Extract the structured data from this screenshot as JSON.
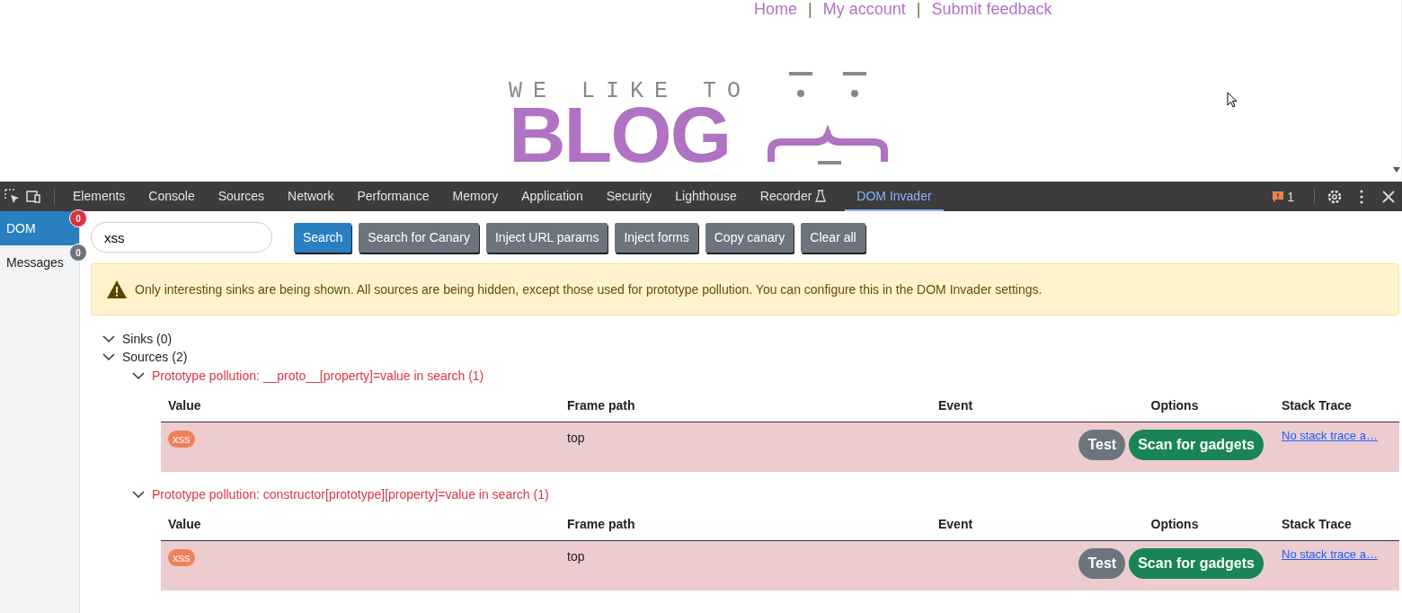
{
  "site": {
    "nav": [
      {
        "kind": "link",
        "text": "Home"
      },
      {
        "kind": "sep",
        "text": "|"
      },
      {
        "kind": "link",
        "text": "My account"
      },
      {
        "kind": "sep",
        "text": "|"
      },
      {
        "kind": "link",
        "text": "Submit feedback"
      }
    ],
    "logo": {
      "tagline": "WE LIKE TO",
      "title": "BLOG"
    }
  },
  "devtools": {
    "tabs": [
      {
        "label": "Elements",
        "selected": false
      },
      {
        "label": "Console",
        "selected": false
      },
      {
        "label": "Sources",
        "selected": false
      },
      {
        "label": "Network",
        "selected": false
      },
      {
        "label": "Performance",
        "selected": false
      },
      {
        "label": "Memory",
        "selected": false
      },
      {
        "label": "Application",
        "selected": false
      },
      {
        "label": "Security",
        "selected": false
      },
      {
        "label": "Lighthouse",
        "selected": false
      },
      {
        "label": "Recorder",
        "selected": false,
        "kind": "experimental"
      },
      {
        "label": "DOM Invader",
        "selected": true
      }
    ],
    "issues_count": "1"
  },
  "sidebar": {
    "items": [
      {
        "label": "DOM",
        "count": "0",
        "selected": true,
        "color": "#e0303e"
      },
      {
        "label": "Messages",
        "count": "0",
        "selected": false,
        "color": "#6c757d"
      }
    ]
  },
  "search": {
    "value": "xss"
  },
  "buttons": [
    {
      "label": "Search",
      "kind": "primary"
    },
    {
      "label": "Search for Canary",
      "kind": "secondary"
    },
    {
      "label": "Inject URL params",
      "kind": "secondary"
    },
    {
      "label": "Inject forms",
      "kind": "secondary"
    },
    {
      "label": "Copy canary",
      "kind": "secondary"
    },
    {
      "label": "Clear all",
      "kind": "secondary"
    }
  ],
  "notice": {
    "text": "Only interesting sinks are being shown. All sources are being hidden, except those used for prototype pollution. You can configure this in the DOM Invader settings."
  },
  "tree": [
    {
      "label": "Sinks (0)",
      "expanded": true
    },
    {
      "label": "Sources (2)",
      "expanded": true,
      "children": [
        {
          "label": "Prototype pollution: __proto__[property]=value in search (1)",
          "expanded": true,
          "table": {
            "columns": [
              "Value",
              "Frame path",
              "Event",
              "Options",
              "Stack Trace"
            ],
            "rows": [
              {
                "value": "xss",
                "frame_path": "top",
                "options": [
                  "Test",
                  "Scan for gadgets"
                ],
                "stack_trace": "No stack trace a…"
              }
            ]
          }
        },
        {
          "label": "Prototype pollution: constructor[prototype][property]=value in search (1)",
          "expanded": true,
          "table": {
            "columns": [
              "Value",
              "Frame path",
              "Event",
              "Options",
              "Stack Trace"
            ],
            "rows": [
              {
                "value": "xss",
                "frame_path": "top",
                "options": [
                  "Test",
                  "Scan for gadgets"
                ],
                "stack_trace": "No stack trace a…"
              }
            ]
          }
        }
      ]
    }
  ]
}
